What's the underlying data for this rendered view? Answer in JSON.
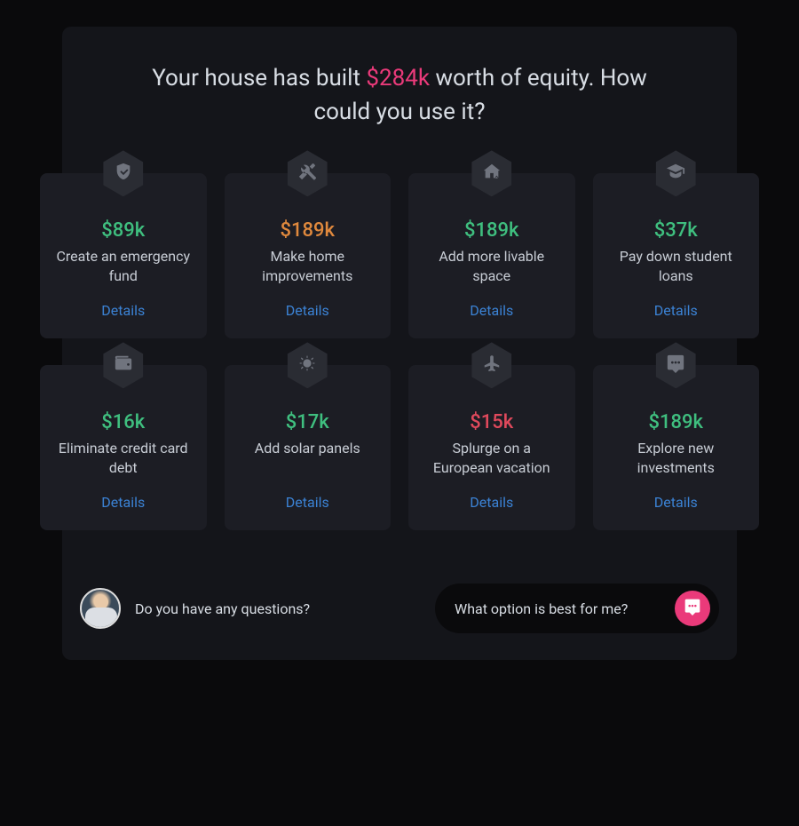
{
  "headline": {
    "pre": "Your house has built ",
    "amount": "$284k",
    "post": " worth of equity. How could you use it?"
  },
  "cards": [
    {
      "icon": "shield",
      "amount": "$89k",
      "amount_color": "green",
      "desc": "Create an emergency fund",
      "details": "Details"
    },
    {
      "icon": "tools",
      "amount": "$189k",
      "amount_color": "orange",
      "desc": "Make home improvements",
      "details": "Details"
    },
    {
      "icon": "house",
      "amount": "$189k",
      "amount_color": "green",
      "desc": "Add more livable space",
      "details": "Details"
    },
    {
      "icon": "gradcap",
      "amount": "$37k",
      "amount_color": "green",
      "desc": "Pay down student loans",
      "details": "Details"
    },
    {
      "icon": "wallet",
      "amount": "$16k",
      "amount_color": "green",
      "desc": "Eliminate credit card debt",
      "details": "Details"
    },
    {
      "icon": "sun",
      "amount": "$17k",
      "amount_color": "green",
      "desc": "Add solar panels",
      "details": "Details"
    },
    {
      "icon": "plane",
      "amount": "$15k",
      "amount_color": "red",
      "desc": "Splurge on a European vacation",
      "details": "Details"
    },
    {
      "icon": "chat",
      "amount": "$189k",
      "amount_color": "green",
      "desc": "Explore new investments",
      "details": "Details"
    }
  ],
  "footer": {
    "question": "Do you have any questions?",
    "prompt": "What option is best for me?"
  }
}
